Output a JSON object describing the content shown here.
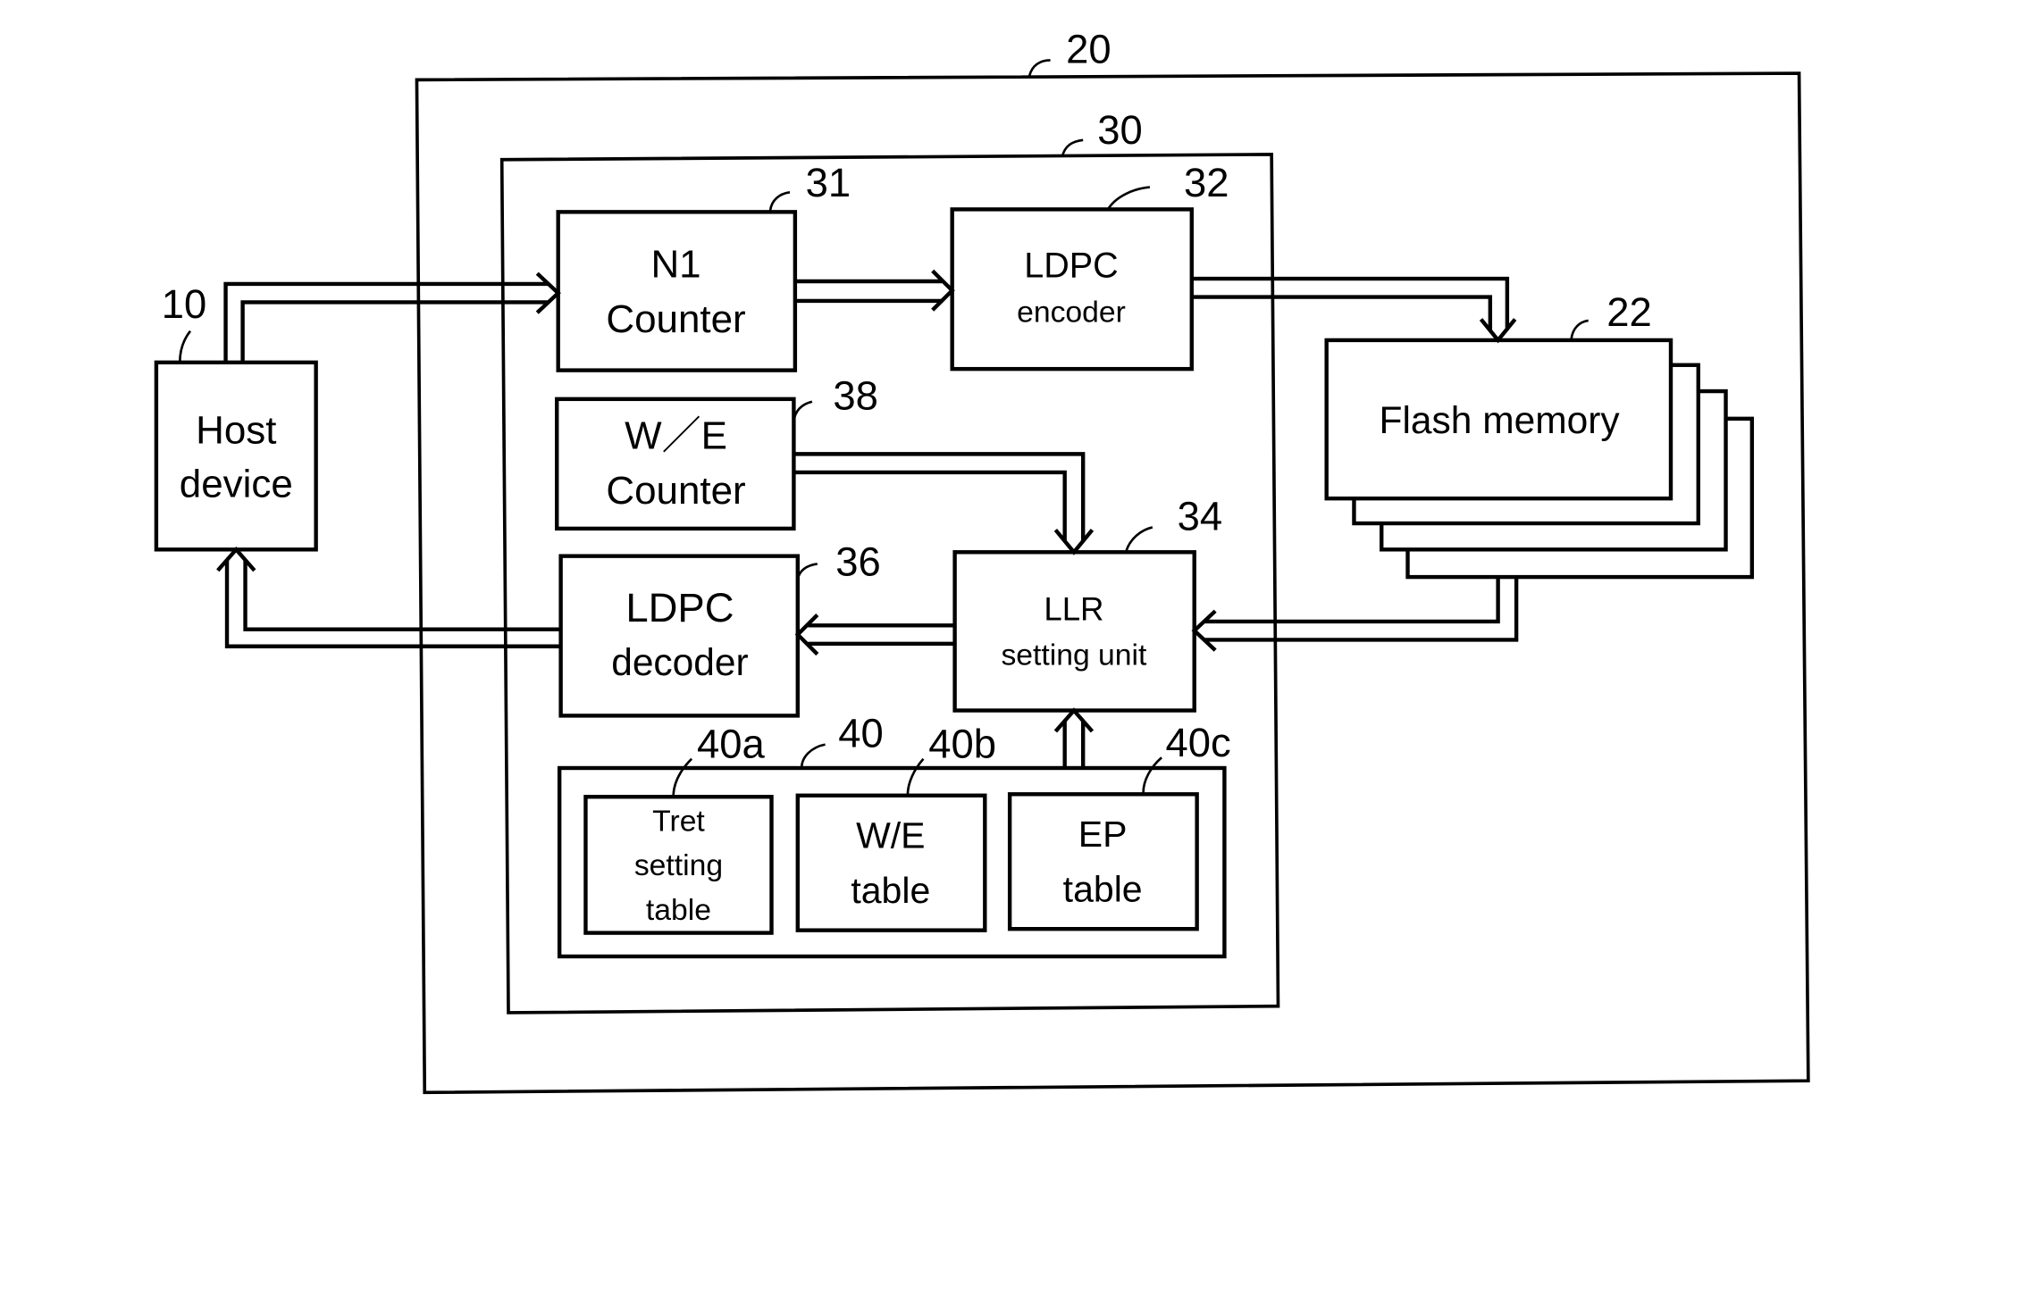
{
  "diagram": {
    "colors": {
      "line": "#000000",
      "background": "#ffffff"
    },
    "ref_labels": {
      "host": "10",
      "system": "20",
      "flash": "22",
      "controller": "30",
      "n1_counter": "31",
      "encoder": "32",
      "llr": "34",
      "decoder": "36",
      "we_counter": "38",
      "tables": "40",
      "tret_table": "40a",
      "we_table": "40b",
      "ep_table": "40c"
    },
    "blocks": {
      "host": [
        "Host",
        "device"
      ],
      "n1_counter": [
        "N1",
        "Counter"
      ],
      "encoder": [
        "LDPC",
        "encoder"
      ],
      "we_counter": [
        "W／E",
        "Counter"
      ],
      "decoder": [
        "LDPC",
        "decoder"
      ],
      "llr": [
        "LLR",
        "setting unit"
      ],
      "flash": [
        "Flash memory"
      ],
      "tret_table": [
        "Tret",
        "setting",
        "table"
      ],
      "we_table": [
        "W/E",
        "table"
      ],
      "ep_table": [
        "EP",
        "table"
      ]
    },
    "connections": [
      {
        "from": "Host device",
        "to": "N1 Counter"
      },
      {
        "from": "N1 Counter",
        "to": "LDPC encoder"
      },
      {
        "from": "LDPC encoder",
        "to": "Flash memory"
      },
      {
        "from": "W/E Counter",
        "to": "LLR setting unit"
      },
      {
        "from": "Flash memory",
        "to": "LLR setting unit"
      },
      {
        "from": "LLR setting unit",
        "to": "LDPC decoder"
      },
      {
        "from": "LDPC decoder",
        "to": "Host device"
      },
      {
        "from": "Tables 40",
        "to": "LLR setting unit"
      }
    ]
  }
}
